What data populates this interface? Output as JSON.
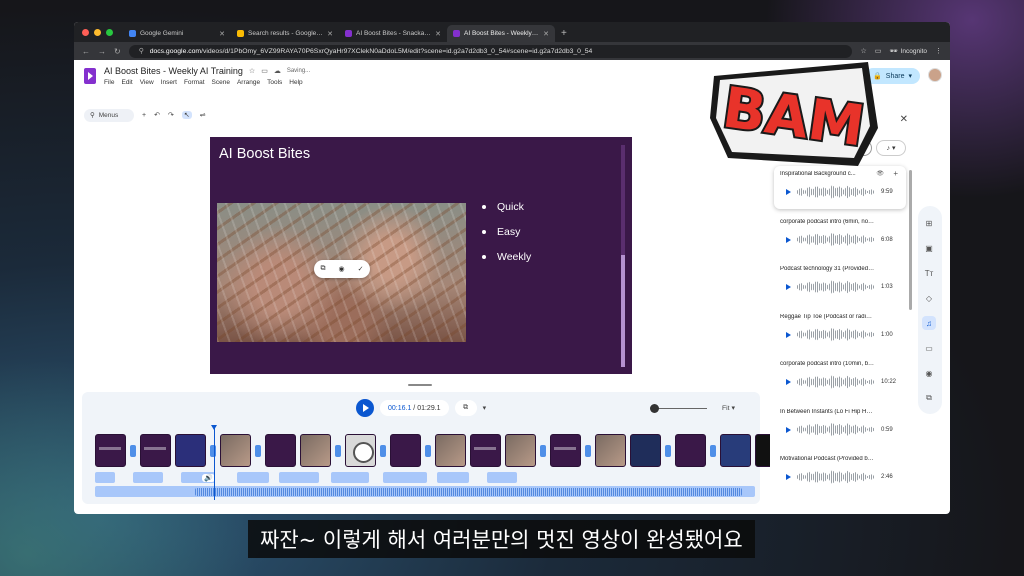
{
  "browser": {
    "tabs": [
      {
        "title": "Google Gemini",
        "color": "#4285f4",
        "active": false
      },
      {
        "title": "Search results - Google Drive",
        "color": "#fbbc04",
        "active": false
      },
      {
        "title": "AI Boost Bites - Snackable Tr",
        "color": "#8430ce",
        "active": false
      },
      {
        "title": "AI Boost Bites - Weekly AI Tr",
        "color": "#8430ce",
        "active": true
      }
    ],
    "url_host": "docs.google.com",
    "url_path": "/videos/d/1PbOmy_6VZ99RAYA70P6SxrQyaHr97XClekN0aDdoL5M/edit?scene=id.g2a7d2db3_0_54#scene=id.g2a7d2db3_0_54",
    "incognito_label": "Incognito"
  },
  "app": {
    "title": "AI Boost Bites - Weekly AI Training",
    "status": "Saving...",
    "menu": [
      "File",
      "Edit",
      "View",
      "Insert",
      "Format",
      "Scene",
      "Arrange",
      "Tools",
      "Help"
    ],
    "play_label": "lay",
    "share_label": "Share",
    "menus_search": "Menus",
    "brand_color": "#8430ce"
  },
  "slide": {
    "title": "AI Boost Bites",
    "bullets": [
      "Quick",
      "Easy",
      "Weekly"
    ],
    "background": "#3a1848"
  },
  "timeline": {
    "current_time": "00:16.1",
    "total_time": "01:29.1",
    "zoom_label": "Fit"
  },
  "music_panel": {
    "tracks": [
      {
        "name": "Inspirational Background c...",
        "duration": "9:59"
      },
      {
        "name": "corporate podcast intro (6min, no dr...",
        "duration": "6:08"
      },
      {
        "name": "Podcast technology 31 (Provided by ...",
        "duration": "1:03"
      },
      {
        "name": "Reggae Tip Toe (Podcast or radio Int...",
        "duration": "1:00"
      },
      {
        "name": "corporate podcast intro (10min, bac...",
        "duration": "10:22"
      },
      {
        "name": "In Between Instants (Lo Fi Hip Hop B...",
        "duration": "0:59"
      },
      {
        "name": "Motivational Podcast (Provided by S...",
        "duration": "2:46"
      }
    ]
  },
  "sticker": {
    "text": "BAM",
    "fill": "#e8332a",
    "outline": "#1a1a1a"
  },
  "subtitle": "짜잔~ 이렇게 해서 여러분만의 멋진 영상이 완성됐어요"
}
